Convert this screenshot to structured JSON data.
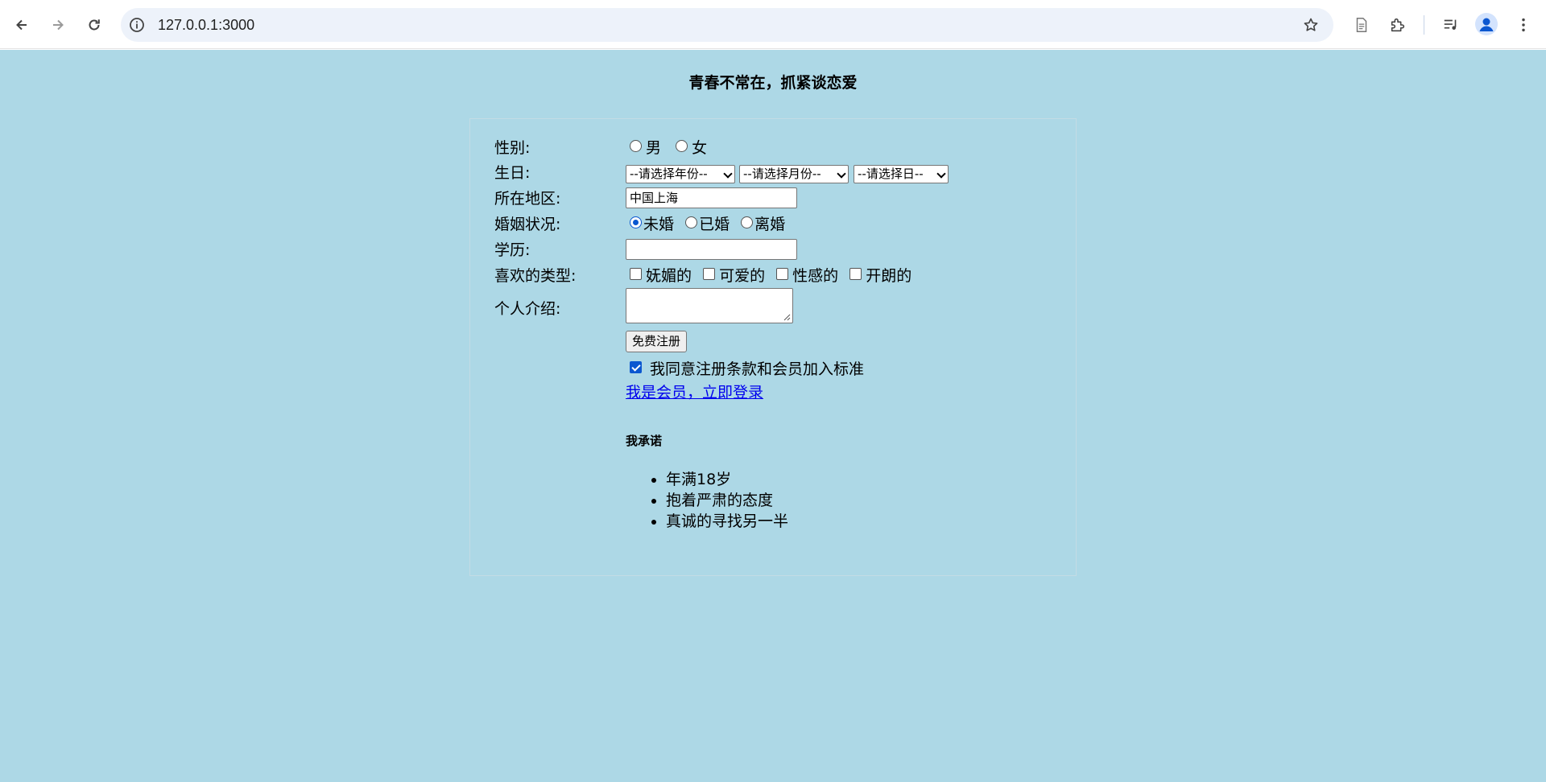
{
  "browser": {
    "url": "127.0.0.1:3000"
  },
  "page": {
    "title": "青春不常在，抓紧谈恋爱",
    "form": {
      "gender": {
        "label": "性别:",
        "options": [
          "男",
          "女"
        ]
      },
      "birthday": {
        "label": "生日:",
        "year_select": "--请选择年份--",
        "month_select": "--请选择月份--",
        "day_select": "--请选择日--"
      },
      "region": {
        "label": "所在地区:",
        "value": "中国上海"
      },
      "marital": {
        "label": "婚姻状况:",
        "options": [
          "未婚",
          "已婚",
          "离婚"
        ],
        "selected": "未婚"
      },
      "education": {
        "label": "学历:",
        "value": ""
      },
      "types": {
        "label": "喜欢的类型:",
        "options": [
          "妩媚的",
          "可爱的",
          "性感的",
          "开朗的"
        ]
      },
      "intro": {
        "label": "个人介绍:"
      },
      "register_button": "免费注册",
      "agree_text": "我同意注册条款和会员加入标准",
      "agree_checked": true,
      "login_link": "我是会员，立即登录",
      "promise": {
        "title": "我承诺",
        "items": [
          "年满18岁",
          "抱着严肃的态度",
          "真诚的寻找另一半"
        ]
      }
    }
  },
  "colors": {
    "page_background": "#add8e6",
    "link": "#0000ee",
    "accent": "#0b57d0"
  }
}
